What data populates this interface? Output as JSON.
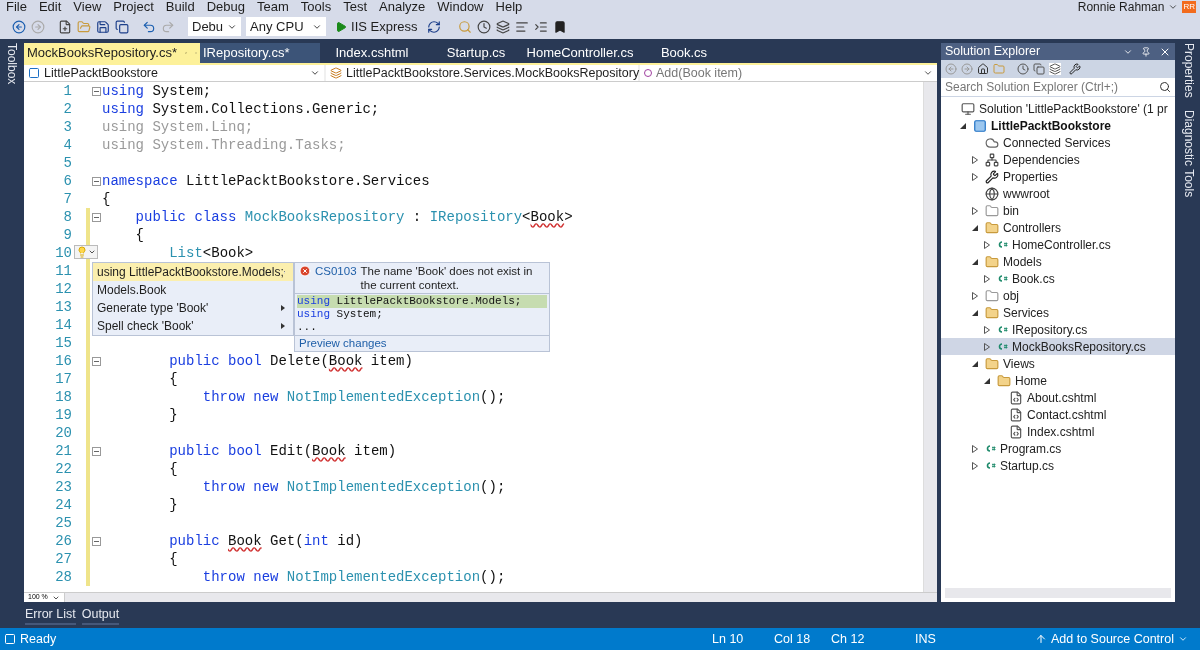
{
  "menu": [
    "File",
    "Edit",
    "View",
    "Project",
    "Build",
    "Debug",
    "Team",
    "Tools",
    "Test",
    "Analyze",
    "Window",
    "Help"
  ],
  "user": {
    "name": "Ronnie Rahman",
    "initials": "RR"
  },
  "toolbar": {
    "configuration": "Debu",
    "platform": "Any CPU",
    "run_target": "IIS Express"
  },
  "left_strip": {
    "label": "Toolbox"
  },
  "tabs": [
    {
      "label": "MockBooksRepository.cs*",
      "selected": true
    },
    {
      "label": "IRepository.cs*",
      "selected": false
    },
    {
      "label": "Index.cshtml",
      "selected": false
    },
    {
      "label": "Startup.cs",
      "selected": false
    },
    {
      "label": "HomeController.cs",
      "selected": false
    },
    {
      "label": "Book.cs",
      "selected": false
    }
  ],
  "navigation": {
    "project": "LittlePacktBookstore",
    "type": "LittlePacktBookstore.Services.MockBooksRepository",
    "member": "Add(Book item)"
  },
  "editor": {
    "lines": [
      {
        "number": "1",
        "fold": true,
        "modified": false,
        "tokens": [
          {
            "kind": "kw",
            "text": "using"
          },
          {
            "kind": "plain",
            "text": " System;"
          }
        ]
      },
      {
        "number": "2",
        "fold": false,
        "modified": false,
        "tokens": [
          {
            "kind": "kw",
            "text": "using"
          },
          {
            "kind": "plain",
            "text": " System.Collections.Generic;"
          }
        ]
      },
      {
        "number": "3",
        "fold": false,
        "modified": false,
        "tokens": [
          {
            "kind": "dim",
            "text": "using System.Linq;"
          }
        ]
      },
      {
        "number": "4",
        "fold": false,
        "modified": false,
        "tokens": [
          {
            "kind": "dim",
            "text": "using System.Threading.Tasks;"
          }
        ]
      },
      {
        "number": "5",
        "fold": false,
        "modified": false
      },
      {
        "number": "6",
        "fold": true,
        "modified": false,
        "tokens": [
          {
            "kind": "kw",
            "text": "namespace"
          },
          {
            "kind": "plain",
            "text": " LittlePacktBookstore.Services"
          }
        ]
      },
      {
        "number": "7",
        "fold": false,
        "modified": false,
        "tokens": [
          {
            "kind": "plain",
            "text": "{"
          }
        ]
      },
      {
        "number": "8",
        "fold": true,
        "modified": true,
        "tokens": [
          {
            "kind": "kw",
            "text": "    public class "
          },
          {
            "kind": "type",
            "text": "MockBooksRepository"
          },
          {
            "kind": "plain",
            "text": " : "
          },
          {
            "kind": "type",
            "text": "IRepository"
          },
          {
            "kind": "plain",
            "text": "<"
          },
          {
            "kind": "err",
            "text": "Book"
          },
          {
            "kind": "plain",
            "text": ">"
          }
        ]
      },
      {
        "number": "9",
        "fold": false,
        "modified": true,
        "tokens": [
          {
            "kind": "plain",
            "text": "    {"
          }
        ]
      },
      {
        "number": "10",
        "fold": false,
        "modified": true,
        "tokens": [
          {
            "kind": "type",
            "text": "        List"
          },
          {
            "kind": "plain",
            "text": "<Book>"
          }
        ]
      },
      {
        "number": "11",
        "fold": false,
        "modified": true
      },
      {
        "number": "12",
        "fold": false,
        "modified": true
      },
      {
        "number": "13",
        "fold": false,
        "modified": true
      },
      {
        "number": "14",
        "fold": false,
        "modified": true
      },
      {
        "number": "15",
        "fold": false,
        "modified": true
      },
      {
        "number": "16",
        "fold": true,
        "modified": true,
        "tokens": [
          {
            "kind": "kw",
            "text": "        public bool"
          },
          {
            "kind": "plain",
            "text": " Delete("
          },
          {
            "kind": "err",
            "text": "Book"
          },
          {
            "kind": "plain",
            "text": " item)"
          }
        ]
      },
      {
        "number": "17",
        "fold": false,
        "modified": true,
        "tokens": [
          {
            "kind": "plain",
            "text": "        {"
          }
        ]
      },
      {
        "number": "18",
        "fold": false,
        "modified": true,
        "tokens": [
          {
            "kind": "kw",
            "text": "            throw new "
          },
          {
            "kind": "type",
            "text": "NotImplementedException"
          },
          {
            "kind": "plain",
            "text": "();"
          }
        ]
      },
      {
        "number": "19",
        "fold": false,
        "modified": true,
        "tokens": [
          {
            "kind": "plain",
            "text": "        }"
          }
        ]
      },
      {
        "number": "20",
        "fold": false,
        "modified": true
      },
      {
        "number": "21",
        "fold": true,
        "modified": true,
        "tokens": [
          {
            "kind": "kw",
            "text": "        public bool"
          },
          {
            "kind": "plain",
            "text": " Edit("
          },
          {
            "kind": "err",
            "text": "Book"
          },
          {
            "kind": "plain",
            "text": " item)"
          }
        ]
      },
      {
        "number": "22",
        "fold": false,
        "modified": true,
        "tokens": [
          {
            "kind": "plain",
            "text": "        {"
          }
        ]
      },
      {
        "number": "23",
        "fold": false,
        "modified": true,
        "tokens": [
          {
            "kind": "kw",
            "text": "            throw new "
          },
          {
            "kind": "type",
            "text": "NotImplementedException"
          },
          {
            "kind": "plain",
            "text": "();"
          }
        ]
      },
      {
        "number": "24",
        "fold": false,
        "modified": true,
        "tokens": [
          {
            "kind": "plain",
            "text": "        }"
          }
        ]
      },
      {
        "number": "25",
        "fold": false,
        "modified": true
      },
      {
        "number": "26",
        "fold": true,
        "modified": true,
        "tokens": [
          {
            "kind": "kw",
            "text": "        public "
          },
          {
            "kind": "err",
            "text": "Book"
          },
          {
            "kind": "plain",
            "text": " Get("
          },
          {
            "kind": "kw",
            "text": "int"
          },
          {
            "kind": "plain",
            "text": " id)"
          }
        ]
      },
      {
        "number": "27",
        "fold": false,
        "modified": true,
        "tokens": [
          {
            "kind": "plain",
            "text": "        {"
          }
        ]
      },
      {
        "number": "28",
        "fold": false,
        "modified": true,
        "tokens": [
          {
            "kind": "kw",
            "text": "            throw new "
          },
          {
            "kind": "type",
            "text": "NotImplementedException"
          },
          {
            "kind": "plain",
            "text": "();"
          }
        ]
      }
    ],
    "zoom": "100 %"
  },
  "quick_actions": {
    "items": [
      {
        "label": "using LittlePacktBookstore.Models;",
        "selected": true,
        "submenu": false
      },
      {
        "label": "Models.Book",
        "selected": false,
        "submenu": false
      },
      {
        "label": "Generate type 'Book'",
        "selected": false,
        "submenu": true
      },
      {
        "label": "Spell check 'Book'",
        "selected": false,
        "submenu": true
      }
    ],
    "preview": {
      "code": "CS0103",
      "message": "The name 'Book' does not exist in the current context.",
      "lines": [
        {
          "keyword": "using",
          "rest": " LittlePacktBookstore.Models;",
          "highlighted": true
        },
        {
          "keyword": "using",
          "rest": " System;",
          "highlighted": false
        }
      ],
      "more": "...",
      "link": "Preview changes"
    }
  },
  "solution_explorer": {
    "title": "Solution Explorer",
    "search_placeholder": "Search Solution Explorer (Ctrl+;)",
    "tree": [
      {
        "label": "Solution 'LittlePacktBookstore' (1 pr",
        "kind": "solution",
        "selected": false,
        "children": [
          {
            "label": "LittlePacktBookstore",
            "kind": "project",
            "expanded": true,
            "selected": false,
            "children": [
              {
                "label": "Connected Services",
                "kind": "cloud",
                "selected": false
              },
              {
                "label": "Dependencies",
                "kind": "dependencies",
                "expanded": false,
                "selected": false
              },
              {
                "label": "Properties",
                "kind": "wrench",
                "expanded": false,
                "selected": false
              },
              {
                "label": "wwwroot",
                "kind": "globe",
                "selected": false
              },
              {
                "label": "bin",
                "kind": "empty-folder",
                "expanded": false,
                "selected": false
              },
              {
                "label": "Controllers",
                "kind": "folder",
                "expanded": true,
                "selected": false,
                "children": [
                  {
                    "label": "HomeController.cs",
                    "kind": "csharp",
                    "expanded": false,
                    "selected": false
                  }
                ]
              },
              {
                "label": "Models",
                "kind": "folder",
                "expanded": true,
                "selected": false,
                "children": [
                  {
                    "label": "Book.cs",
                    "kind": "csharp",
                    "expanded": false,
                    "selected": false
                  }
                ]
              },
              {
                "label": "obj",
                "kind": "empty-folder",
                "expanded": false,
                "selected": false
              },
              {
                "label": "Services",
                "kind": "folder",
                "expanded": true,
                "selected": false,
                "children": [
                  {
                    "label": "IRepository.cs",
                    "kind": "csharp",
                    "expanded": false,
                    "selected": false
                  },
                  {
                    "label": "MockBooksRepository.cs",
                    "kind": "csharp",
                    "expanded": false,
                    "selected": true
                  }
                ]
              },
              {
                "label": "Views",
                "kind": "folder",
                "expanded": true,
                "selected": false,
                "children": [
                  {
                    "label": "Home",
                    "kind": "folder",
                    "expanded": true,
                    "selected": false,
                    "children": [
                      {
                        "label": "About.cshtml",
                        "kind": "page",
                        "selected": false
                      },
                      {
                        "label": "Contact.cshtml",
                        "kind": "page",
                        "selected": false
                      },
                      {
                        "label": "Index.cshtml",
                        "kind": "page",
                        "selected": false
                      }
                    ]
                  }
                ]
              },
              {
                "label": "Program.cs",
                "kind": "csharp",
                "expanded": false,
                "selected": false
              },
              {
                "label": "Startup.cs",
                "kind": "csharp",
                "expanded": false,
                "selected": false
              }
            ]
          }
        ]
      }
    ]
  },
  "right_strip": [
    "Properties",
    "Diagnostic Tools"
  ],
  "bottom_tabs": [
    "Error List",
    "Output"
  ],
  "status_bar": {
    "state": "Ready",
    "line": "Ln 10",
    "column": "Col 18",
    "character": "Ch 12",
    "mode": "INS",
    "source_control": "Add to Source Control"
  }
}
